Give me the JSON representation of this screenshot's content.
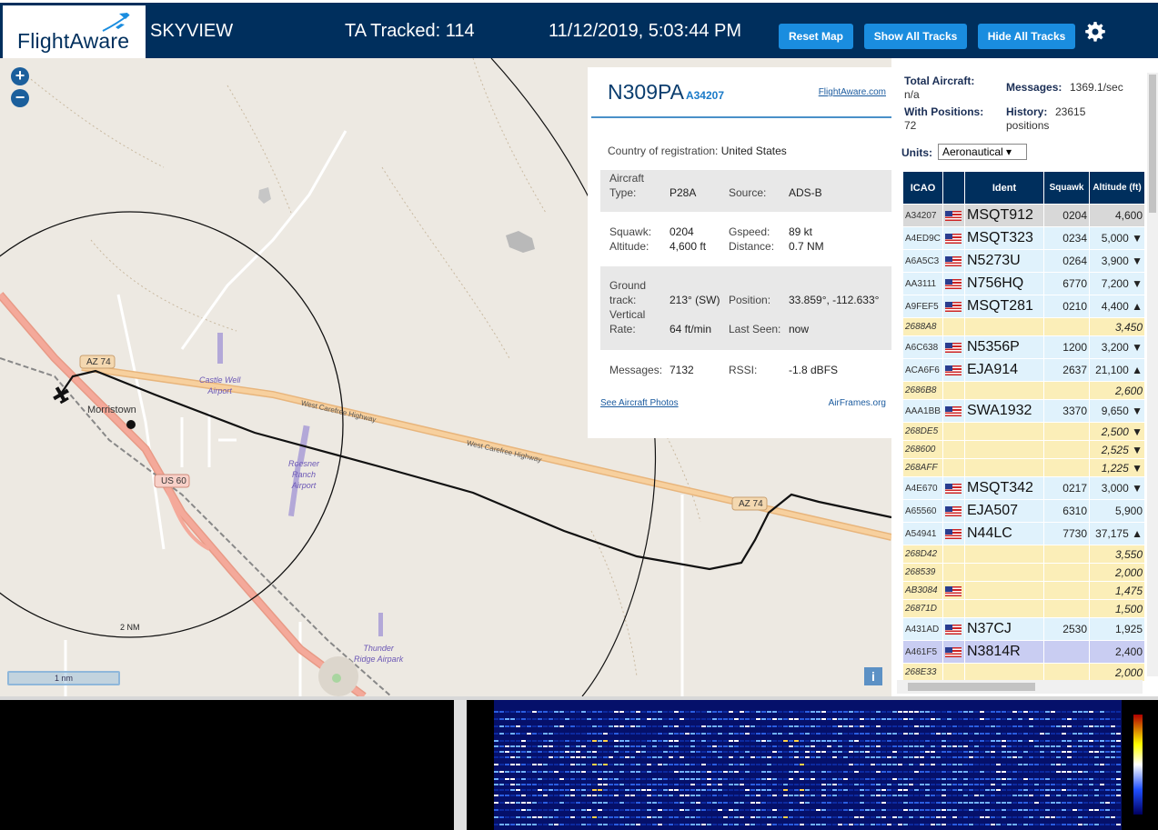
{
  "header": {
    "logo": "FlightAware",
    "app_name": "SKYVIEW",
    "tracked": "TA Tracked: 114",
    "datetime": "11/12/2019, 5:03:44 PM",
    "buttons": {
      "reset": "Reset Map",
      "show": "Show All Tracks",
      "hide": "Hide All Tracks"
    }
  },
  "map": {
    "zoom_in": "+",
    "zoom_out": "−",
    "town": "Morristown",
    "road_az74_a": "AZ 74",
    "road_az74_b": "AZ 74",
    "road_us60": "US 60",
    "highway_label_1": "West Carefree Highway",
    "highway_label_2": "West Carefree Highway",
    "airport_1": [
      "Castle Well",
      "Airport"
    ],
    "airport_2": [
      "Roesner",
      "Ranch",
      "Airport"
    ],
    "airport_3": [
      "Thunder",
      "Ridge Airpark"
    ],
    "range_ring_label": "2 NM",
    "scale": "1 nm",
    "info": "i"
  },
  "popup": {
    "registration": "N309PA",
    "hex": "A34207",
    "fa_link": "FlightAware.com",
    "country_label": "Country of registration:",
    "country": "United States",
    "aircraft_type_label": "Aircraft",
    "type_label": "Type:",
    "type": "P28A",
    "source_label": "Source:",
    "source": "ADS-B",
    "squawk_label": "Squawk:",
    "squawk": "0204",
    "gspeed_label": "Gspeed:",
    "gspeed": "89 kt",
    "altitude_label": "Altitude:",
    "altitude": "4,600 ft",
    "distance_label": "Distance:",
    "distance": "0.7 NM",
    "ground_label": "Ground",
    "track_label": "track:",
    "track": "213° (SW)",
    "position_label": "Position:",
    "position": "33.859°, -112.633°",
    "vertical_label": "Vertical",
    "rate_label": "Rate:",
    "rate": "64 ft/min",
    "last_seen_label": "Last Seen:",
    "last_seen": "now",
    "messages_label": "Messages:",
    "messages": "7132",
    "rssi_label": "RSSI:",
    "rssi": "-1.8 dBFS",
    "photos_link": "See Aircraft Photos",
    "airframes_link": "AirFrames.org"
  },
  "sidebar": {
    "total_label": "Total Aircraft:",
    "total_value": "n/a",
    "messages_label": "Messages:",
    "messages_value": "1369.1/sec",
    "positions_label": "With Positions:",
    "positions_value": "72",
    "history_label": "History:",
    "history_value": "23615",
    "history_unit": "positions",
    "units_label": "Units:",
    "units_value": "Aeronautical ▾",
    "columns": [
      "ICAO",
      "",
      "Ident",
      "Squawk",
      "Altitude (ft)"
    ],
    "rows": [
      {
        "icao": "A34207",
        "flag": true,
        "ident": "MSQT912",
        "squawk": "0204",
        "alt": "4,600",
        "kind": "sel"
      },
      {
        "icao": "A4ED9C",
        "flag": true,
        "ident": "MSQT323",
        "squawk": "0234",
        "alt": "5,000 ▼",
        "kind": "adsb"
      },
      {
        "icao": "A6A5C3",
        "flag": true,
        "ident": "N5273U",
        "squawk": "0264",
        "alt": "3,900 ▼",
        "kind": "adsb"
      },
      {
        "icao": "AA3111",
        "flag": true,
        "ident": "N756HQ",
        "squawk": "6770",
        "alt": "7,200 ▼",
        "kind": "adsb"
      },
      {
        "icao": "A9FEF5",
        "flag": true,
        "ident": "MSQT281",
        "squawk": "0210",
        "alt": "4,400 ▲",
        "kind": "adsb"
      },
      {
        "icao": "2688A8",
        "flag": false,
        "ident": "",
        "squawk": "",
        "alt": "3,450",
        "kind": "mlat"
      },
      {
        "icao": "A6C638",
        "flag": true,
        "ident": "N5356P",
        "squawk": "1200",
        "alt": "3,200 ▼",
        "kind": "adsb"
      },
      {
        "icao": "ACA6F6",
        "flag": true,
        "ident": "EJA914",
        "squawk": "2637",
        "alt": "21,100 ▲",
        "kind": "adsb"
      },
      {
        "icao": "2686B8",
        "flag": false,
        "ident": "",
        "squawk": "",
        "alt": "2,600",
        "kind": "mlat"
      },
      {
        "icao": "AAA1BB",
        "flag": true,
        "ident": "SWA1932",
        "squawk": "3370",
        "alt": "9,650 ▼",
        "kind": "adsb"
      },
      {
        "icao": "268DE5",
        "flag": false,
        "ident": "",
        "squawk": "",
        "alt": "2,500 ▼",
        "kind": "mlat"
      },
      {
        "icao": "268600",
        "flag": false,
        "ident": "",
        "squawk": "",
        "alt": "2,525 ▼",
        "kind": "mlat"
      },
      {
        "icao": "268AFF",
        "flag": false,
        "ident": "",
        "squawk": "",
        "alt": "1,225 ▼",
        "kind": "mlat"
      },
      {
        "icao": "A4E670",
        "flag": true,
        "ident": "MSQT342",
        "squawk": "0217",
        "alt": "3,000 ▼",
        "kind": "adsb"
      },
      {
        "icao": "A65560",
        "flag": true,
        "ident": "EJA507",
        "squawk": "6310",
        "alt": "5,900",
        "kind": "adsb"
      },
      {
        "icao": "A54941",
        "flag": true,
        "ident": "N44LC",
        "squawk": "7730",
        "alt": "37,175 ▲",
        "kind": "adsb"
      },
      {
        "icao": "268D42",
        "flag": false,
        "ident": "",
        "squawk": "",
        "alt": "3,550",
        "kind": "mlat"
      },
      {
        "icao": "268539",
        "flag": false,
        "ident": "",
        "squawk": "",
        "alt": "2,000",
        "kind": "mlat"
      },
      {
        "icao": "AB3084",
        "flag": true,
        "ident": "",
        "squawk": "",
        "alt": "1,475",
        "kind": "mlat"
      },
      {
        "icao": "26871D",
        "flag": false,
        "ident": "",
        "squawk": "",
        "alt": "1,500",
        "kind": "mlat"
      },
      {
        "icao": "A431AD",
        "flag": true,
        "ident": "N37CJ",
        "squawk": "2530",
        "alt": "1,925",
        "kind": "adsb"
      },
      {
        "icao": "A461F5",
        "flag": true,
        "ident": "N3814R",
        "squawk": "",
        "alt": "2,400",
        "kind": "hl"
      },
      {
        "icao": "268E33",
        "flag": false,
        "ident": "",
        "squawk": "",
        "alt": "2,000",
        "kind": "mlat"
      }
    ]
  },
  "colors": {
    "header_bg": "#002f5d",
    "button": "#1a8ddf",
    "adsb_row": "#e0f2fc",
    "mlat_row": "#fbeeb8"
  },
  "icons": {
    "settings": "gear-icon",
    "logo_plane": "plane-icon",
    "aircraft": "aircraft-marker-icon"
  }
}
